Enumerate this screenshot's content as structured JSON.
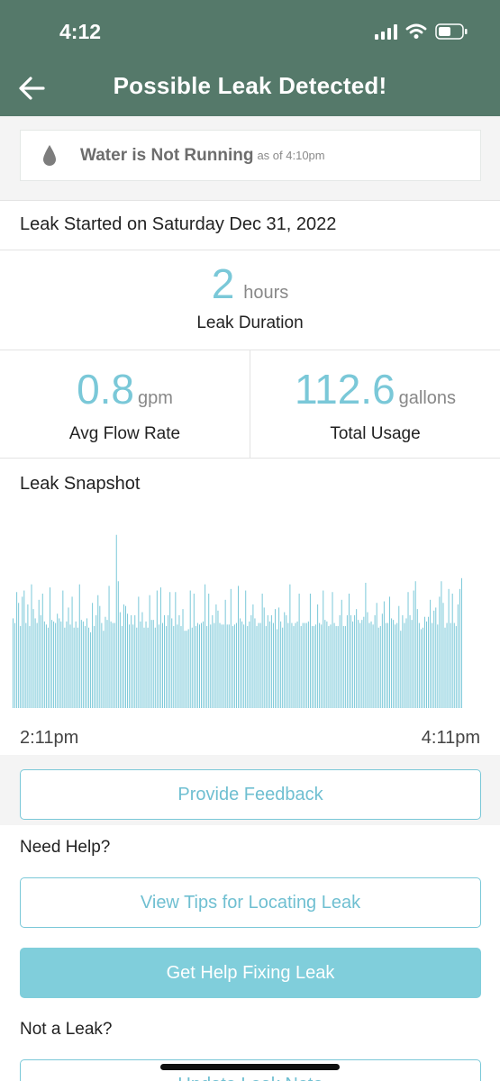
{
  "status_bar": {
    "time": "4:12"
  },
  "header": {
    "title": "Possible Leak Detected!"
  },
  "water_status": {
    "text": "Water is Not Running",
    "sub": "as of 4:10pm"
  },
  "leak_started": "Leak Started on Saturday Dec 31, 2022",
  "duration": {
    "value": "2",
    "unit": "hours",
    "label": "Leak Duration"
  },
  "avg_flow": {
    "value": "0.8",
    "unit": "gpm",
    "label": "Avg Flow Rate"
  },
  "total_usage": {
    "value": "112.6",
    "unit": "gallons",
    "label": "Total Usage"
  },
  "snapshot": {
    "title": "Leak Snapshot",
    "start_label": "2:11pm",
    "end_label": "4:11pm"
  },
  "chart_data": {
    "type": "bar",
    "x_start": "2:11pm",
    "x_end": "4:11pm",
    "values": [
      0.58,
      0.55,
      0.75,
      0.68,
      0.53,
      0.72,
      0.76,
      0.55,
      0.67,
      0.53,
      0.8,
      0.64,
      0.58,
      0.55,
      0.7,
      0.6,
      0.74,
      0.56,
      0.54,
      0.52,
      0.78,
      0.57,
      0.56,
      0.55,
      0.61,
      0.58,
      0.56,
      0.76,
      0.52,
      0.56,
      0.65,
      0.54,
      0.72,
      0.52,
      0.56,
      0.52,
      0.8,
      0.57,
      0.56,
      0.53,
      0.58,
      0.52,
      0.49,
      0.68,
      0.53,
      0.6,
      0.73,
      0.66,
      0.55,
      0.5,
      0.59,
      0.57,
      0.79,
      0.56,
      0.55,
      0.55,
      1.12,
      0.82,
      0.62,
      0.53,
      0.67,
      0.66,
      0.61,
      0.54,
      0.6,
      0.54,
      0.6,
      0.52,
      0.72,
      0.56,
      0.62,
      0.52,
      0.56,
      0.52,
      0.73,
      0.57,
      0.57,
      0.52,
      0.76,
      0.54,
      0.78,
      0.55,
      0.6,
      0.53,
      0.6,
      0.75,
      0.58,
      0.53,
      0.75,
      0.54,
      0.6,
      0.53,
      0.64,
      0.5,
      0.5,
      0.51,
      0.76,
      0.52,
      0.74,
      0.53,
      0.55,
      0.54,
      0.55,
      0.56,
      0.8,
      0.53,
      0.74,
      0.54,
      0.6,
      0.55,
      0.67,
      0.63,
      0.55,
      0.54,
      0.54,
      0.7,
      0.54,
      0.54,
      0.77,
      0.53,
      0.54,
      0.55,
      0.79,
      0.58,
      0.56,
      0.54,
      0.76,
      0.53,
      0.56,
      0.6,
      0.67,
      0.58,
      0.53,
      0.55,
      0.55,
      0.74,
      0.65,
      0.53,
      0.6,
      0.56,
      0.6,
      0.55,
      0.64,
      0.51,
      0.65,
      0.56,
      0.52,
      0.62,
      0.6,
      0.55,
      0.8,
      0.55,
      0.53,
      0.55,
      0.56,
      0.74,
      0.53,
      0.55,
      0.55,
      0.55,
      0.56,
      0.74,
      0.53,
      0.53,
      0.54,
      0.67,
      0.55,
      0.54,
      0.76,
      0.57,
      0.56,
      0.53,
      0.54,
      0.75,
      0.55,
      0.53,
      0.53,
      0.6,
      0.7,
      0.53,
      0.53,
      0.6,
      0.74,
      0.6,
      0.56,
      0.6,
      0.64,
      0.57,
      0.55,
      0.57,
      0.59,
      0.81,
      0.62,
      0.55,
      0.56,
      0.54,
      0.6,
      0.68,
      0.52,
      0.53,
      0.61,
      0.69,
      0.55,
      0.55,
      0.72,
      0.58,
      0.57,
      0.54,
      0.55,
      0.66,
      0.5,
      0.6,
      0.55,
      0.58,
      0.75,
      0.6,
      0.57,
      0.76,
      0.82,
      0.64,
      0.55,
      0.51,
      0.52,
      0.59,
      0.56,
      0.59,
      0.7,
      0.55,
      0.63,
      0.65,
      0.54,
      0.72,
      0.82,
      0.68,
      0.52,
      0.55,
      0.77,
      0.55,
      0.74,
      0.55,
      0.53,
      0.67,
      0.77,
      0.84
    ],
    "ylim": [
      0,
      1.2
    ],
    "color": "#7ac8d8"
  },
  "buttons": {
    "feedback": "Provide Feedback",
    "tips": "View Tips for Locating Leak",
    "get_help": "Get Help Fixing Leak",
    "update": "Update Leak Note"
  },
  "sections": {
    "need_help": "Need Help?",
    "not_leak": "Not a Leak?"
  },
  "colors": {
    "header": "#55796a",
    "accent": "#7ac8d8"
  }
}
